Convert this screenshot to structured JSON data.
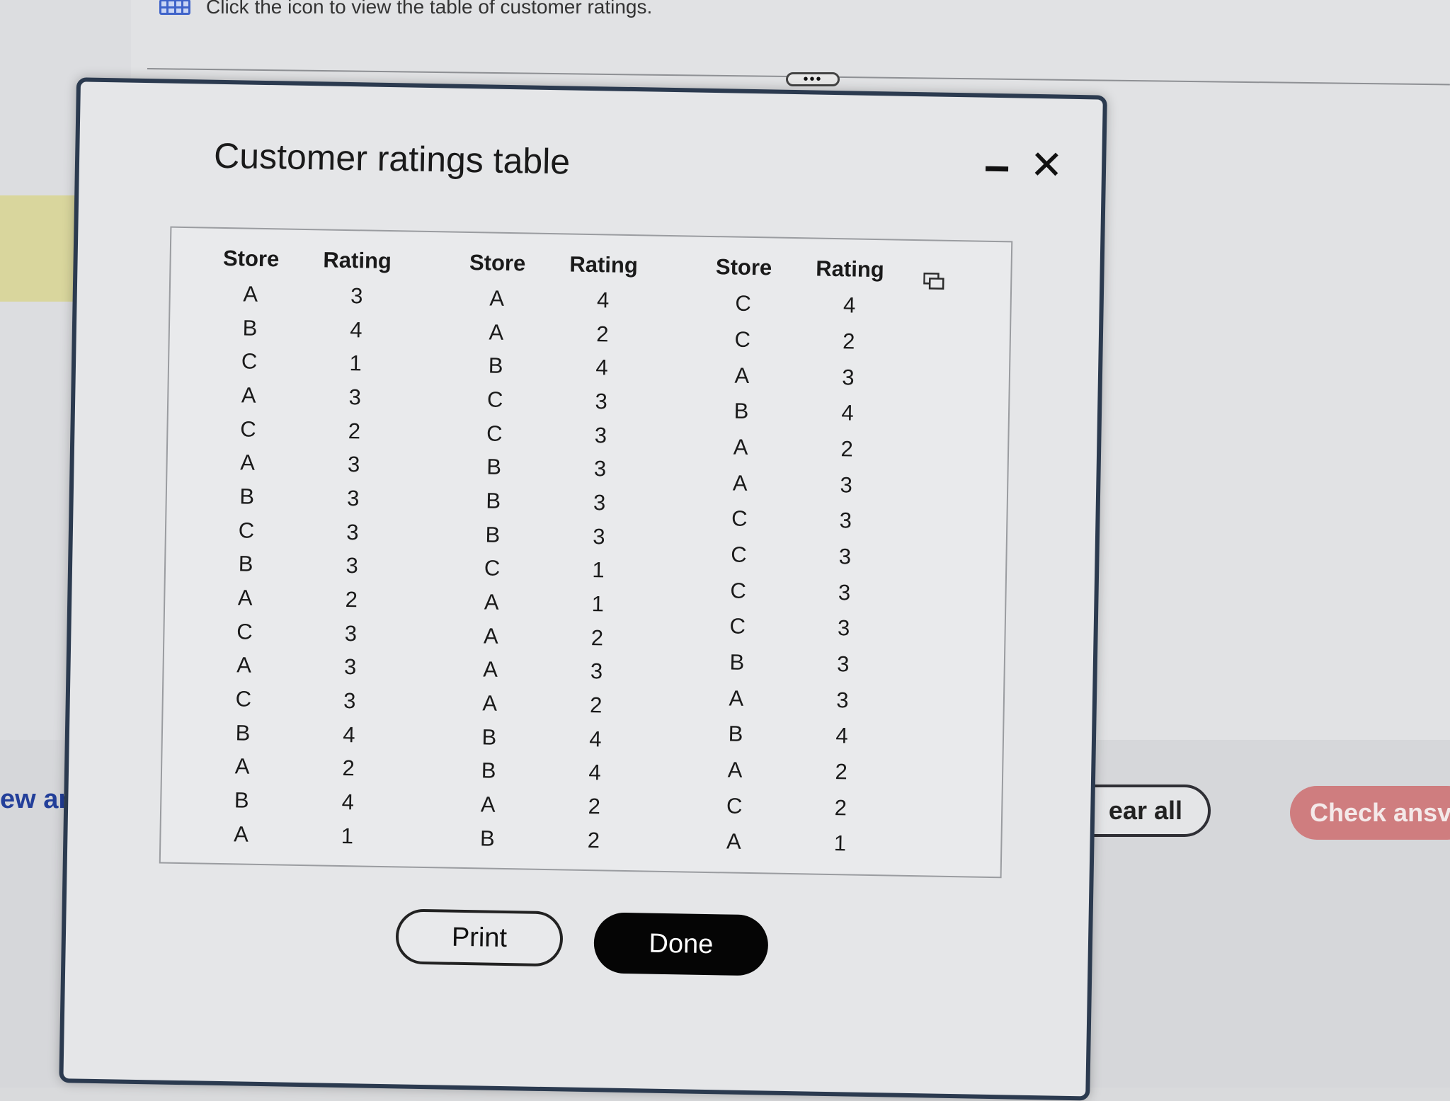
{
  "page": {
    "instruction": "Click the icon to view the table of customer ratings.",
    "left_edge_text": "ew an",
    "clear_all_label": "ear all",
    "check_answer_label": "Check ansv"
  },
  "modal": {
    "title": "Customer ratings table",
    "print_label": "Print",
    "done_label": "Done",
    "columns": [
      {
        "store_header": "Store",
        "rating_header": "Rating",
        "rows": [
          [
            "A",
            "3"
          ],
          [
            "B",
            "4"
          ],
          [
            "C",
            "1"
          ],
          [
            "A",
            "3"
          ],
          [
            "C",
            "2"
          ],
          [
            "A",
            "3"
          ],
          [
            "B",
            "3"
          ],
          [
            "C",
            "3"
          ],
          [
            "B",
            "3"
          ],
          [
            "A",
            "2"
          ],
          [
            "C",
            "3"
          ],
          [
            "A",
            "3"
          ],
          [
            "C",
            "3"
          ],
          [
            "B",
            "4"
          ],
          [
            "A",
            "2"
          ],
          [
            "B",
            "4"
          ],
          [
            "A",
            "1"
          ]
        ]
      },
      {
        "store_header": "Store",
        "rating_header": "Rating",
        "rows": [
          [
            "A",
            "4"
          ],
          [
            "A",
            "2"
          ],
          [
            "B",
            "4"
          ],
          [
            "C",
            "3"
          ],
          [
            "C",
            "3"
          ],
          [
            "B",
            "3"
          ],
          [
            "B",
            "3"
          ],
          [
            "B",
            "3"
          ],
          [
            "C",
            "1"
          ],
          [
            "A",
            "1"
          ],
          [
            "A",
            "2"
          ],
          [
            "A",
            "3"
          ],
          [
            "A",
            "2"
          ],
          [
            "B",
            "4"
          ],
          [
            "B",
            "4"
          ],
          [
            "A",
            "2"
          ],
          [
            "B",
            "2"
          ]
        ]
      },
      {
        "store_header": "Store",
        "rating_header": "Rating",
        "rows": [
          [
            "C",
            "4"
          ],
          [
            "C",
            "2"
          ],
          [
            "A",
            "3"
          ],
          [
            "B",
            "4"
          ],
          [
            "A",
            "2"
          ],
          [
            "A",
            "3"
          ],
          [
            "C",
            "3"
          ],
          [
            "C",
            "3"
          ],
          [
            "C",
            "3"
          ],
          [
            "C",
            "3"
          ],
          [
            "B",
            "3"
          ],
          [
            "A",
            "3"
          ],
          [
            "B",
            "4"
          ],
          [
            "A",
            "2"
          ],
          [
            "C",
            "2"
          ],
          [
            "A",
            "1"
          ]
        ]
      }
    ]
  },
  "colors": {
    "accent_blue": "#3f63c9",
    "check_button": "#cf7d7f",
    "done_button": "#050505"
  }
}
